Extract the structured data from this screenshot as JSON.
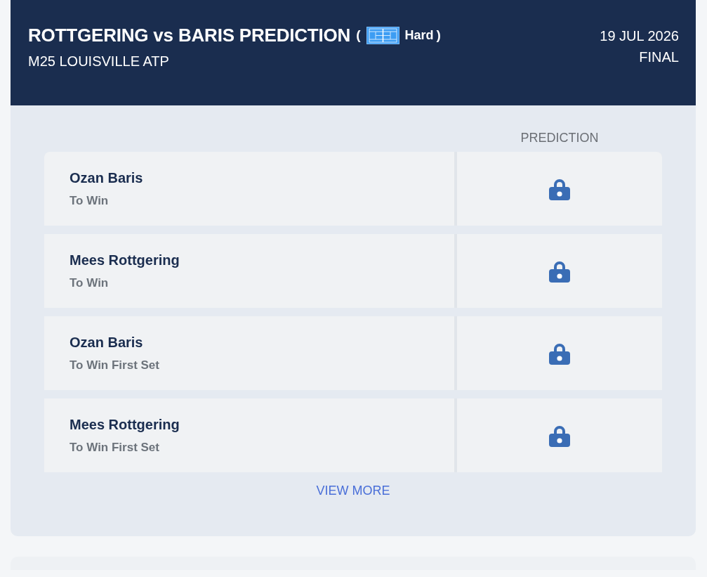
{
  "header": {
    "title": "ROTTGERING vs BARIS PREDICTION",
    "surface": {
      "open": "(",
      "label": "Hard",
      "close": ")"
    },
    "tournament": "M25 LOUISVILLE ATP",
    "date": "19 JUL 2026",
    "status": "FINAL"
  },
  "table": {
    "columns": [
      {
        "label": "PREDICTION"
      }
    ],
    "rows": [
      {
        "player": "Ozan Baris",
        "market": "To Win",
        "locked": true
      },
      {
        "player": "Mees Rottgering",
        "market": "To Win",
        "locked": true
      },
      {
        "player": "Ozan Baris",
        "market": "To Win First Set",
        "locked": true
      },
      {
        "player": "Mees Rottgering",
        "market": "To Win First Set",
        "locked": true
      }
    ]
  },
  "view_more": "VIEW MORE"
}
